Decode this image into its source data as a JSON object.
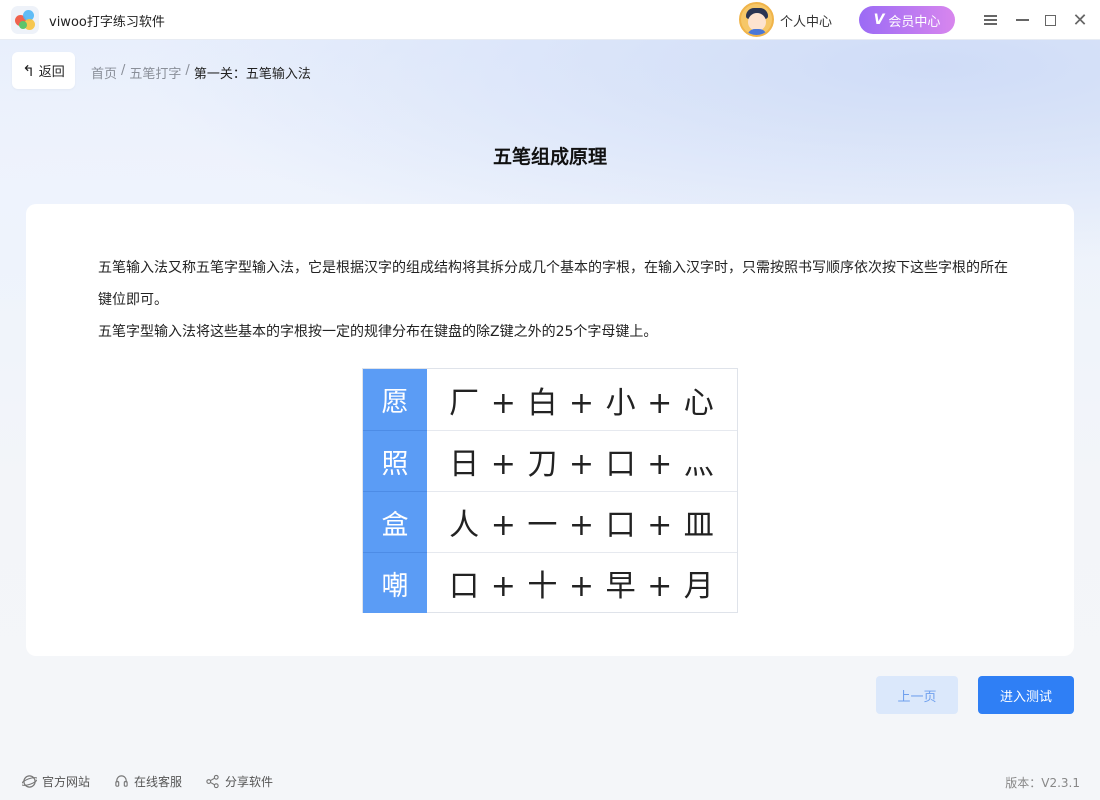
{
  "app": {
    "title": "viwoo打字练习软件"
  },
  "header": {
    "personal_center": "个人中心",
    "vip_badge": "V",
    "vip_label": "会员中心"
  },
  "nav": {
    "back_label": "返回",
    "back_icon": "↰",
    "breadcrumb": [
      "首页",
      "五笔打字",
      "第一关：五笔输入法"
    ],
    "separator": "/"
  },
  "main": {
    "title": "五笔组成原理",
    "para1": "五笔输入法又称五笔字型输入法，它是根据汉字的组成结构将其拆分成几个基本的字根，在输入汉字时，只需按照书写顺序依次按下这些字根的所在键位即可。",
    "para2": "五笔字型输入法将这些基本的字根按一定的规律分布在键盘的除Z键之外的25个字母键上。",
    "examples": [
      {
        "char": "愿",
        "parts": "厂 + 白 + 小 + 心"
      },
      {
        "char": "照",
        "parts": "日 + 刀 + 口 + 灬"
      },
      {
        "char": "盒",
        "parts": "人 + 一 + 口 + 皿"
      },
      {
        "char": "嘲",
        "parts": "口 + 十 + 早 + 月"
      }
    ]
  },
  "actions": {
    "prev": "上一页",
    "next": "进入测试"
  },
  "footer": {
    "website": "官方网站",
    "service": "在线客服",
    "share": "分享软件",
    "version": "版本：V2.3.1"
  },
  "colors": {
    "primary": "#2f7ff5",
    "key_bg": "#5b9cf5",
    "vip_start": "#9b6bf5",
    "vip_end": "#d886ee"
  }
}
